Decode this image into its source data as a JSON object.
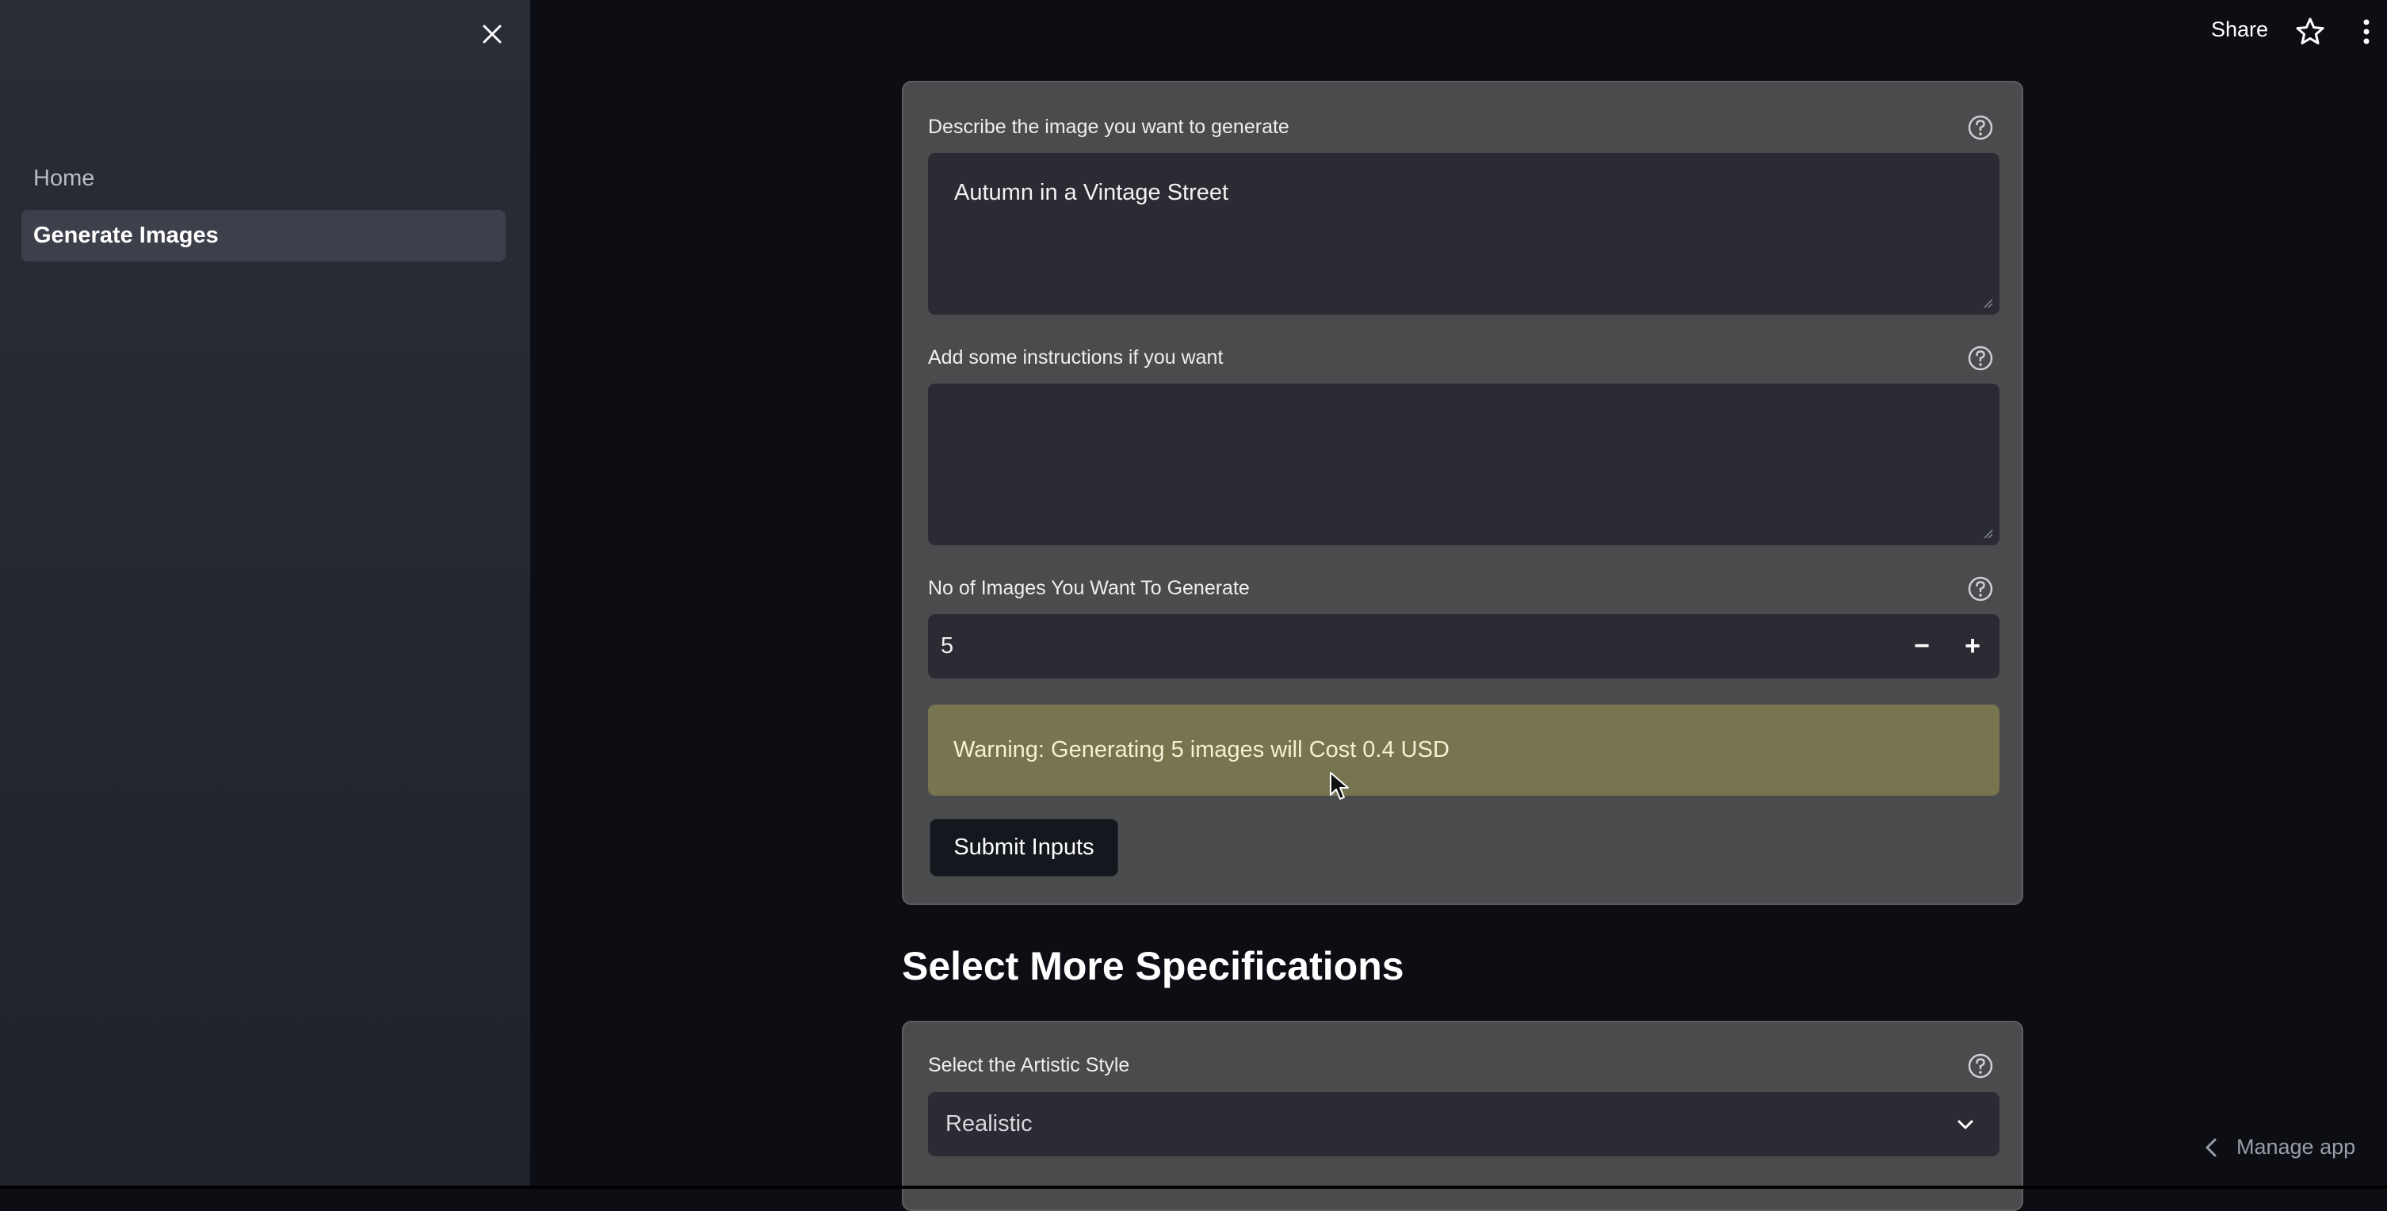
{
  "sidebar": {
    "close_icon": "close-icon",
    "items": [
      {
        "label": "Home",
        "active": false
      },
      {
        "label": "Generate Images",
        "active": true
      }
    ]
  },
  "toolbar": {
    "share_label": "Share",
    "star_icon": "star-icon",
    "menu_icon": "kebab-menu-icon"
  },
  "form": {
    "description": {
      "label": "Describe the image you want to generate",
      "value": "Autumn in a Vintage Street"
    },
    "instructions": {
      "label": "Add some instructions if you want",
      "value": ""
    },
    "num_images": {
      "label": "No of Images You Want To Generate",
      "value": "5",
      "minus": "−",
      "plus": "+"
    },
    "warning": "Warning: Generating 5 images will Cost 0.4 USD",
    "submit_label": "Submit Inputs"
  },
  "specs": {
    "heading": "Select More Specifications",
    "artistic_style": {
      "label": "Select the Artistic Style",
      "value": "Realistic"
    }
  },
  "footer": {
    "manage_app_label": "Manage app"
  },
  "colors": {
    "background": "#0c0e14",
    "sidebar": "#2a2c36",
    "card": "#4a4b4d",
    "input": "#2a2b33",
    "warning": "#77754f"
  }
}
